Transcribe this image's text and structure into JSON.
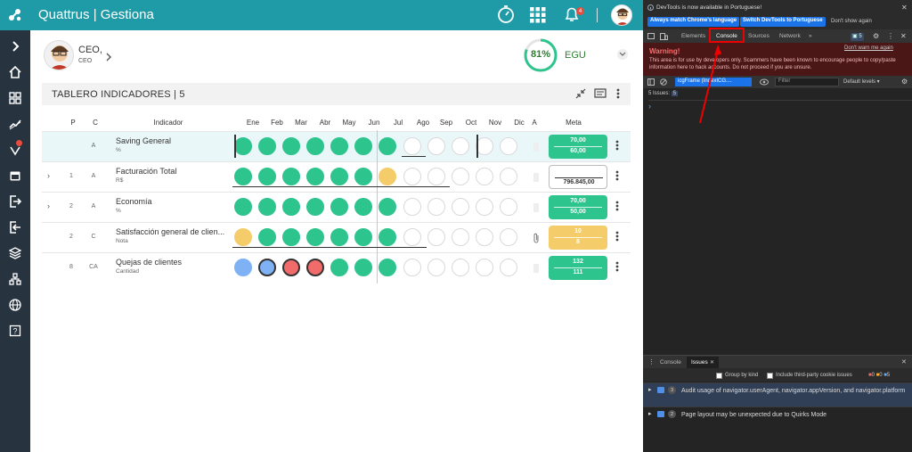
{
  "app": {
    "title": "Quattrus | Gestiona",
    "notifications_count": "4"
  },
  "sidebar": {
    "items": [
      {
        "name": "chevron-right-icon"
      },
      {
        "name": "home-icon"
      },
      {
        "name": "dashboard-icon"
      },
      {
        "name": "trend-icon"
      },
      {
        "name": "alert-icon"
      },
      {
        "name": "calendar-icon"
      },
      {
        "name": "export-icon"
      },
      {
        "name": "import-icon"
      },
      {
        "name": "layers-icon"
      },
      {
        "name": "org-icon"
      },
      {
        "name": "globe-icon"
      },
      {
        "name": "help-icon"
      }
    ]
  },
  "profile": {
    "name": "CEO,",
    "role": "CEO"
  },
  "score": {
    "percent_label": "81%",
    "percent": 81,
    "label": "EGU",
    "color": "#2ec48e"
  },
  "panel": {
    "title": "TABLERO INDICADORES | 5"
  },
  "columns": {
    "p": "P",
    "c": "C",
    "indicator": "Indicador",
    "months": [
      "Ene",
      "Feb",
      "Mar",
      "Abr",
      "May",
      "Jun",
      "Jul",
      "Ago",
      "Sep",
      "Oct",
      "Nov",
      "Dic"
    ],
    "a": "A",
    "meta": "Meta"
  },
  "rows": [
    {
      "p": "",
      "c": "A",
      "name": "Saving General",
      "unit": "%",
      "expand": "",
      "status": [
        "g",
        "g",
        "g",
        "g",
        "g",
        "g",
        "g",
        "e",
        "e",
        "e",
        "e",
        "e"
      ],
      "meta_top": "70,00",
      "meta_bottom": "60,00",
      "meta_style": "green",
      "highlight": true
    },
    {
      "p": "1",
      "c": "A",
      "name": "Facturación Total",
      "unit": "R$",
      "expand": "›",
      "status": [
        "g",
        "g",
        "g",
        "g",
        "g",
        "g",
        "y",
        "e",
        "e",
        "e",
        "e",
        "e"
      ],
      "meta_top": "",
      "meta_bottom": "796.845,00",
      "meta_style": "outline",
      "highlight": false
    },
    {
      "p": "2",
      "c": "A",
      "name": "Economía",
      "unit": "%",
      "expand": "›",
      "status": [
        "g",
        "g",
        "g",
        "g",
        "g",
        "g",
        "g",
        "e",
        "e",
        "e",
        "e",
        "e"
      ],
      "meta_top": "70,00",
      "meta_bottom": "50,00",
      "meta_style": "green",
      "highlight": false
    },
    {
      "p": "2",
      "c": "C",
      "name": "Satisfacción general de clien...",
      "unit": "Nota",
      "expand": "",
      "status": [
        "y",
        "g",
        "g",
        "g",
        "g",
        "g",
        "g",
        "e",
        "e",
        "e",
        "e",
        "e"
      ],
      "meta_top": "10",
      "meta_bottom": "8",
      "meta_style": "yellow",
      "highlight": false
    },
    {
      "p": "8",
      "c": "CA",
      "name": "Quejas de clientes",
      "unit": "Cantidad",
      "expand": "",
      "status": [
        "b",
        "bb",
        "rb",
        "rb",
        "g",
        "g",
        "g",
        "e",
        "e",
        "e",
        "e",
        "e"
      ],
      "meta_top": "132",
      "meta_bottom": "111",
      "meta_style": "green",
      "highlight": false
    }
  ],
  "devtools": {
    "info": "DevTools is now available in Portuguese!",
    "btn_match": "Always match Chrome's language",
    "btn_switch": "Switch DevTools to Portuguese",
    "dont_show": "Don't show again",
    "tabs": [
      "Elements",
      "Console",
      "Sources",
      "Network",
      "»"
    ],
    "issues_badge": "5",
    "warning_title": "Warning!",
    "warning_link": "Don't warn me again",
    "warning_text": "This area is for use by developers only. Scammers have been known to encourage people to copy/paste information here to hack accounts. Do not proceed if you are unsure.",
    "context": "icgFrame (IndexICG....",
    "filter": "Filter",
    "levels": "Default levels ▾",
    "issues_line": "5 Issues:",
    "issues_line_count": "5",
    "prompt": "›",
    "drawer_tabs": [
      "Console",
      "Issues"
    ],
    "group_by_kind": "Group by kind",
    "third_party": "Include third-party cookie issues",
    "counts": [
      "0",
      "0",
      "5"
    ],
    "issues": [
      {
        "count": "3",
        "text": "Audit usage of navigator.userAgent, navigator.appVersion, and navigator.platform"
      },
      {
        "count": "2",
        "text": "Page layout may be unexpected due to Quirks Mode"
      }
    ]
  }
}
